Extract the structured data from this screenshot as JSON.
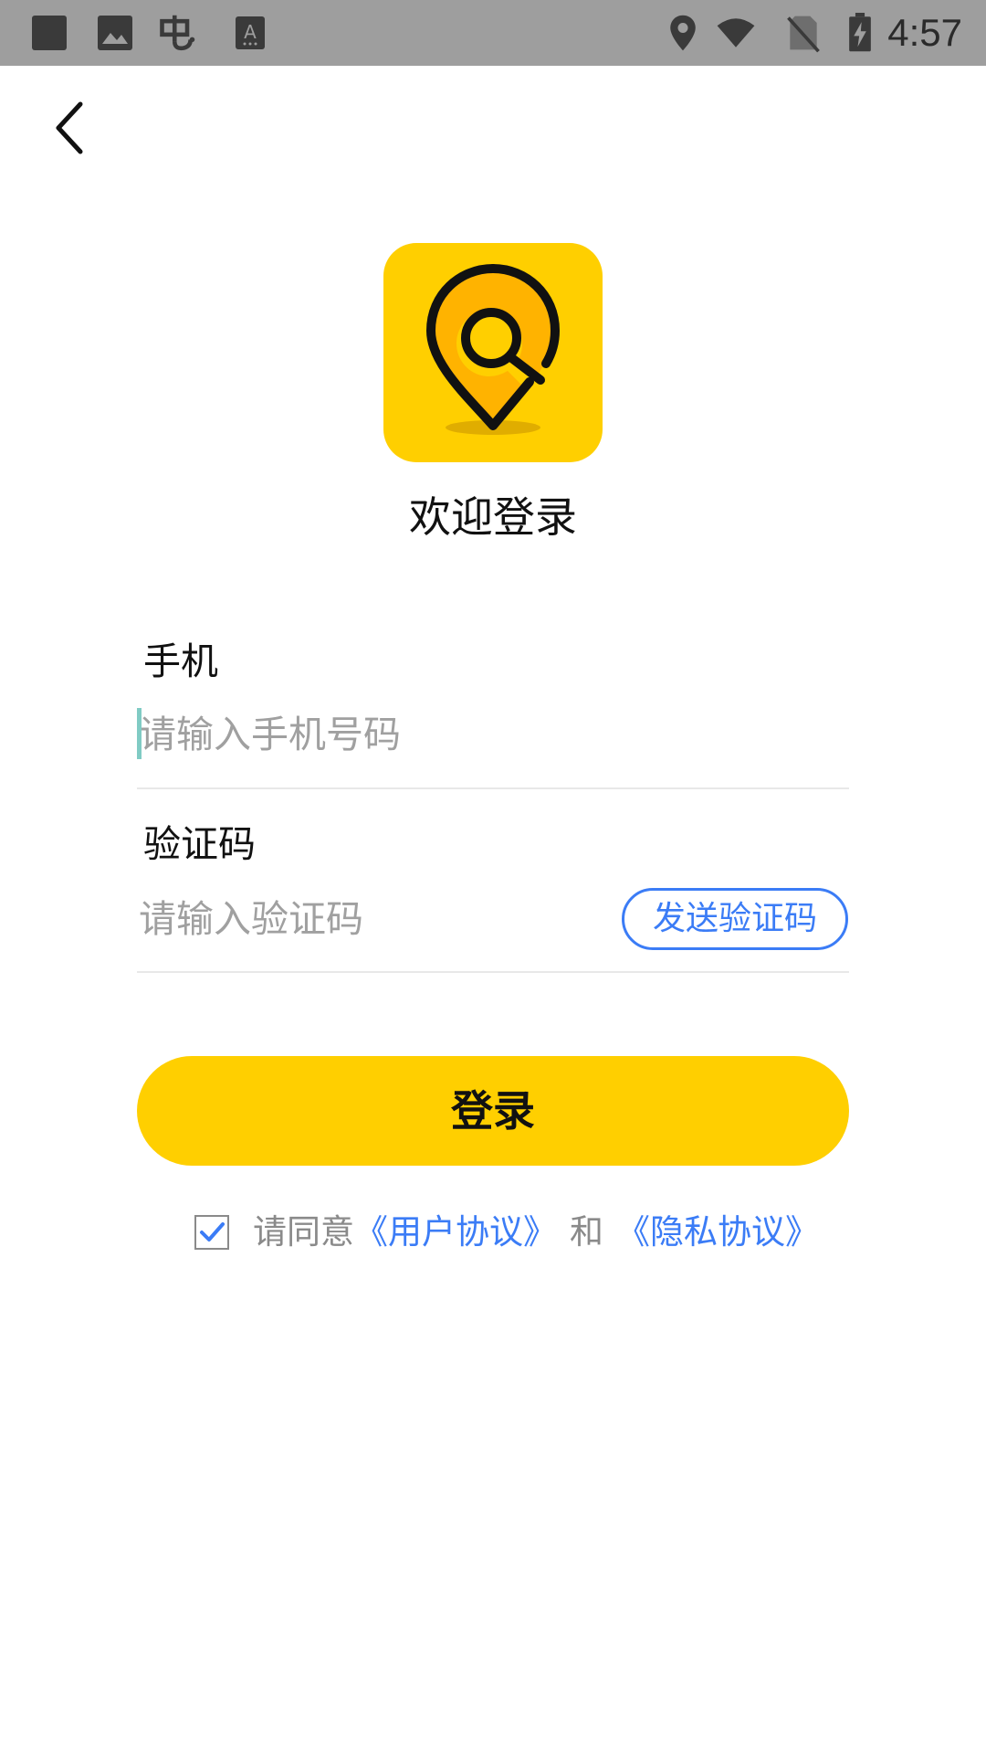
{
  "status_bar": {
    "time": "4:57",
    "icons": [
      "square-app-icon",
      "image-icon",
      "bug-icon",
      "font-icon",
      "location-icon",
      "wifi-icon",
      "no-sim-icon",
      "battery-charging-icon"
    ]
  },
  "header": {
    "back_icon": "chevron-left-icon"
  },
  "logo": {
    "icon": "location-search-icon",
    "background_color": "#ffcf00"
  },
  "welcome_title": "欢迎登录",
  "form": {
    "phone": {
      "label": "手机",
      "value": "",
      "placeholder": "请输入手机号码"
    },
    "code": {
      "label": "验证码",
      "value": "",
      "placeholder": "请输入验证码",
      "send_button_label": "发送验证码"
    }
  },
  "login_button_label": "登录",
  "agreement": {
    "checked": true,
    "prefix": "请同意",
    "user_agreement": "《用户协议》",
    "and": "和",
    "privacy_agreement": "《隐私协议》"
  },
  "colors": {
    "accent": "#ffcf00",
    "link": "#3b7cf6",
    "status_bar": "#9e9e9e"
  }
}
